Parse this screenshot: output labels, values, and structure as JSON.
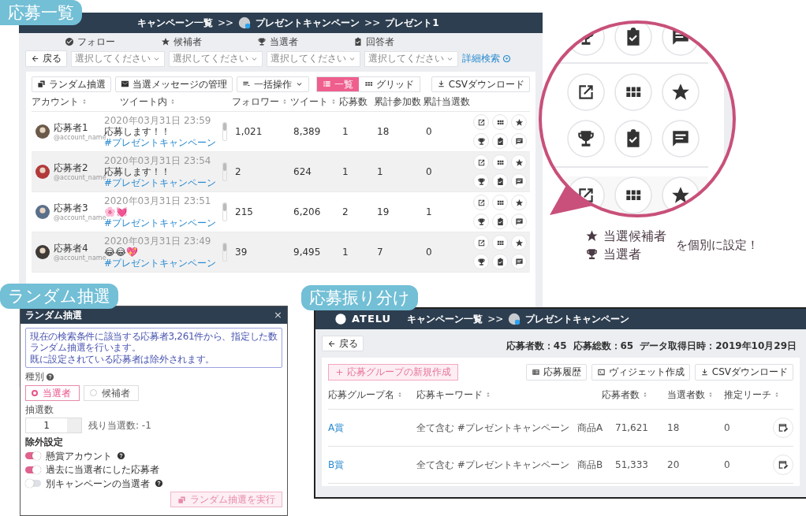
{
  "list_screen": {
    "callout": "応募一覧",
    "breadcrumb": [
      "キャンペーン一覧",
      ">>",
      "プレゼントキャンペーン",
      ">>",
      "プレゼント1"
    ],
    "filters": [
      {
        "kind": "follow",
        "label": "フォロー",
        "placeholder": "選択してください"
      },
      {
        "kind": "candidate",
        "label": "候補者",
        "placeholder": "選択してください"
      },
      {
        "kind": "winner",
        "label": "当選者",
        "placeholder": "選択してください"
      },
      {
        "kind": "answer",
        "label": "回答者",
        "placeholder": "選択してください"
      }
    ],
    "back_button": "戻る",
    "advanced_search": "詳細検索",
    "toolbar": {
      "random_draw": "ランダム抽選",
      "messages": "当選メッセージの管理",
      "bulk": "一括操作",
      "csv": "CSVダウンロード",
      "views": [
        {
          "kind": "list",
          "label": "一覧",
          "selected": true
        },
        {
          "kind": "grid",
          "label": "グリッド",
          "selected": false
        }
      ]
    },
    "columns": [
      {
        "label": "アカウント",
        "sortable": true
      },
      {
        "label": "ツイート内",
        "sortable": true
      },
      {
        "label": "フォロワー",
        "sortable": true
      },
      {
        "label": "ツイート",
        "sortable": true
      },
      {
        "label": "応募数",
        "sortable": false
      },
      {
        "label": "累計参加数",
        "sortable": false
      },
      {
        "label": "累計当選数",
        "sortable": false
      }
    ],
    "rows": [
      {
        "name": "応募者1",
        "handle": "@account_name",
        "date": "2020年03月31日 23:59",
        "text": "応募します！！",
        "hashtag": "#プレゼントキャンペーン",
        "followers": "1,021",
        "tweets": "8,389",
        "entries": "1",
        "total_entries": "18",
        "total_wins": "0",
        "shaded": false
      },
      {
        "name": "応募者2",
        "handle": "@account_name",
        "date": "2020年03月31日 23:54",
        "text": "応募します！！",
        "hashtag": "#プレゼントキャンペーン",
        "followers": "2",
        "tweets": "624",
        "entries": "1",
        "total_entries": "1",
        "total_wins": "0",
        "shaded": true
      },
      {
        "name": "応募者3",
        "handle": "@account_name",
        "date": "2020年03月31日 23:51",
        "text": "🌸💓",
        "hashtag": "#プレゼントキャンペーン",
        "followers": "215",
        "tweets": "6,206",
        "entries": "2",
        "total_entries": "19",
        "total_wins": "1",
        "shaded": false
      },
      {
        "name": "応募者4",
        "handle": "@account_name",
        "date": "2020年03月31日 23:49",
        "text": "😂😂💖",
        "hashtag": "#プレゼントキャンペーン",
        "followers": "39",
        "tweets": "9,495",
        "entries": "1",
        "total_entries": "7",
        "total_wins": "0",
        "shaded": true
      }
    ]
  },
  "magnifier": {
    "legend": [
      {
        "kind": "star",
        "label": "当選候補者"
      },
      {
        "kind": "trophy",
        "label": "当選者"
      }
    ],
    "note": "を個別に設定！"
  },
  "random_modal": {
    "callout": "ランダム抽選",
    "title": "ランダム抽選",
    "close": "×",
    "info": [
      "現在の検索条件に該当する応募者3,261件から、指定した数ランダム抽選を行います。",
      "既に設定されている応募者は除外されます。"
    ],
    "type_label": "種別",
    "types": [
      {
        "label": "当選者",
        "selected": true
      },
      {
        "label": "候補者",
        "selected": false
      }
    ],
    "count_label": "抽選数",
    "count_value": "1",
    "remaining": "残り当選数: -1",
    "exclusion_title": "除外設定",
    "exclusions": [
      {
        "label": "懸賞アカウント",
        "on": true,
        "help": true
      },
      {
        "label": "過去に当選者にした応募者",
        "on": true,
        "help": false
      },
      {
        "label": "別キャンペーンの当選者",
        "on": false,
        "help": true
      }
    ],
    "run_button": "ランダム抽選を実行",
    "run_disabled": true
  },
  "group_screen": {
    "callout": "応募振り分け",
    "logo": "ATELU",
    "breadcrumb": [
      "キャンペーン一覧",
      ">>",
      "プレゼントキャンペーン"
    ],
    "back_button": "戻る",
    "stats": [
      "応募者数：45",
      "応募総数：65",
      "データ取得日時：2019年10月29日"
    ],
    "new_group": "応募グループの新規作成",
    "actions": [
      {
        "kind": "history",
        "label": "応募履歴"
      },
      {
        "kind": "widget",
        "label": "ヴィジェット作成"
      },
      {
        "kind": "download",
        "label": "CSVダウンロード"
      }
    ],
    "columns": [
      "応募グループ名",
      "応募キーワード",
      "応募者数",
      "当選者数",
      "推定リーチ"
    ],
    "rows": [
      {
        "name": "A賞",
        "keyword": "全て含む #プレゼントキャンペーン",
        "product": "商品A",
        "applicants": "71,621",
        "winners": "18",
        "reach": "0"
      },
      {
        "name": "B賞",
        "keyword": "全て含む #プレゼントキャンペーン",
        "product": "商品B",
        "applicants": "51,333",
        "winners": "20",
        "reach": "0"
      }
    ]
  }
}
